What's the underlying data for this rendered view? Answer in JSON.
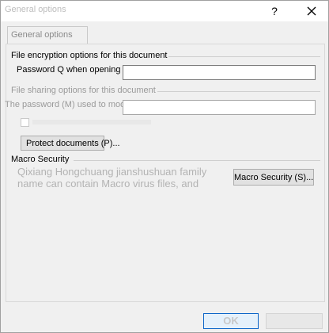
{
  "window": {
    "title": "General options",
    "help_label": "?"
  },
  "tabs": [
    {
      "label": "General options"
    }
  ],
  "encryption": {
    "section_title": "File encryption options for this document",
    "password_open_label": "Password Q when opening the file):",
    "password_open_value": ""
  },
  "sharing": {
    "section_title": "File sharing options for this document",
    "password_modify_label": "The password (M) used to modify the file:",
    "password_modify_value": "",
    "protect_button": "Protect documents (P)..."
  },
  "macro": {
    "section_title": "Macro Security",
    "description_line1": "Qixiang Hongchuang jianshushuan family",
    "description_line2": "name can contain Macro virus files, and",
    "button_label": "Macro Security (S)..."
  },
  "footer": {
    "ok_label": "OK"
  }
}
